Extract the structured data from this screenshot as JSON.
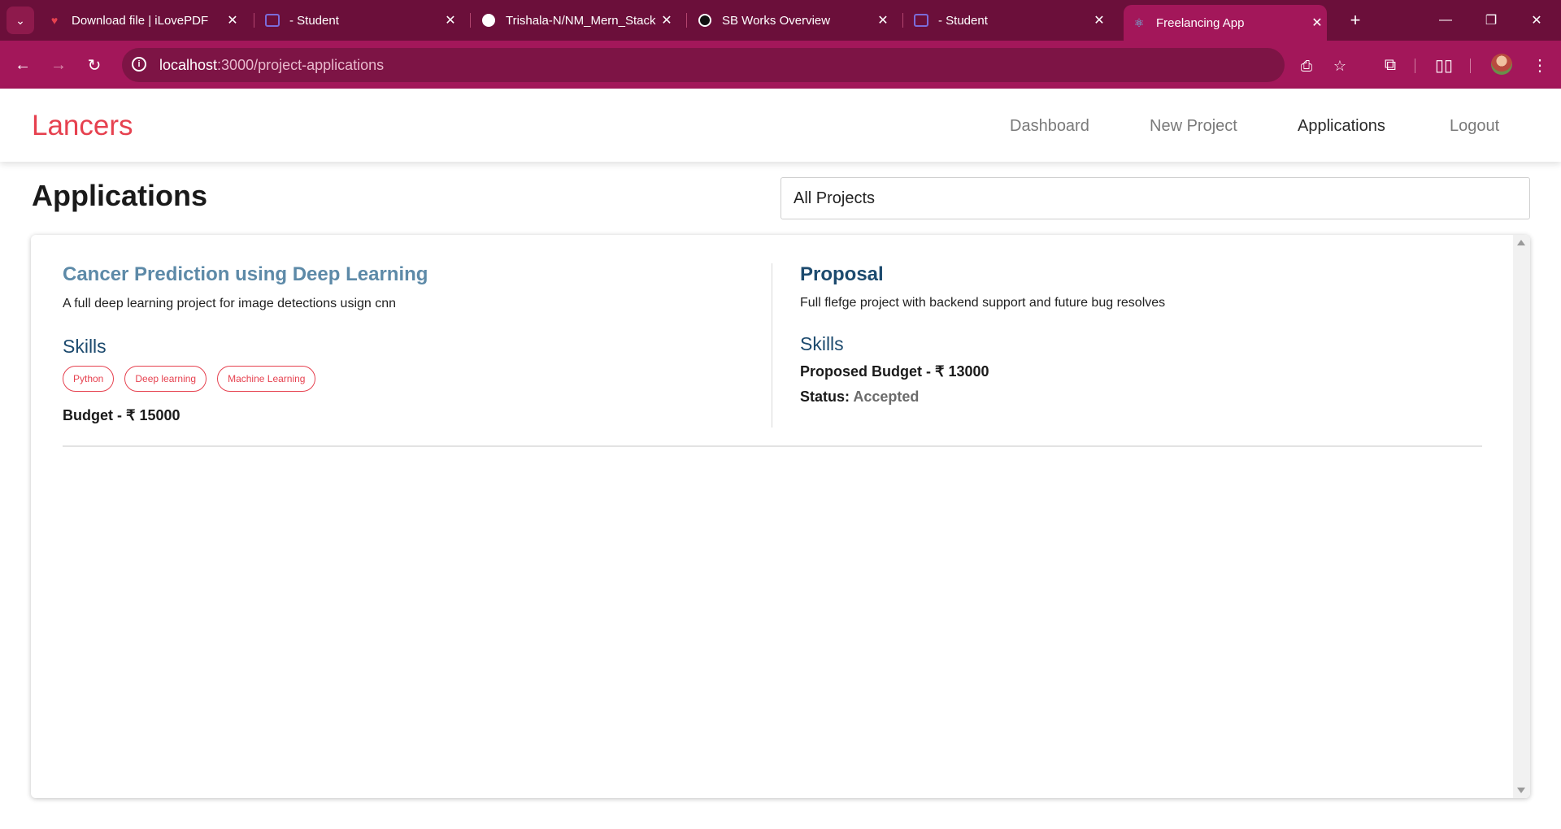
{
  "browser": {
    "tabs": [
      {
        "title": "Download file | iLovePDF",
        "icon": "ilovepdf-heart-icon"
      },
      {
        "title": "- Student",
        "icon": "student-portal-icon"
      },
      {
        "title": "Trishala-N/NM_Mern_Stack",
        "icon": "github-icon"
      },
      {
        "title": "SB Works Overview",
        "icon": "openai-icon"
      },
      {
        "title": "- Student",
        "icon": "student-portal-icon"
      },
      {
        "title": "Freelancing App",
        "icon": "react-icon"
      }
    ],
    "url_host": "localhost",
    "url_path": ":3000/project-applications",
    "theme": {
      "tabstrip": "#6b0f3a",
      "toolbar": "#a3175a"
    }
  },
  "app": {
    "brand": "Lancers",
    "brand_color": "#e6414f",
    "nav": [
      "Dashboard",
      "New Project",
      "Applications",
      "Logout"
    ],
    "active_nav": "Applications"
  },
  "page": {
    "title": "Applications",
    "filter_selected": "All Projects"
  },
  "application": {
    "project": {
      "title": "Cancer Prediction using Deep Learning",
      "description": "A full deep learning project for image detections usign cnn",
      "skills_heading": "Skills",
      "skills": [
        "Python",
        "Deep learning",
        "Machine Learning"
      ],
      "budget_label": "Budget - ₹ 15000"
    },
    "proposal": {
      "heading": "Proposal",
      "description": "Full flefge project with backend support and future bug resolves",
      "skills_heading": "Skills",
      "budget_label": "Proposed Budget - ₹ 13000",
      "status_label": "Status:",
      "status_value": "Accepted"
    }
  }
}
